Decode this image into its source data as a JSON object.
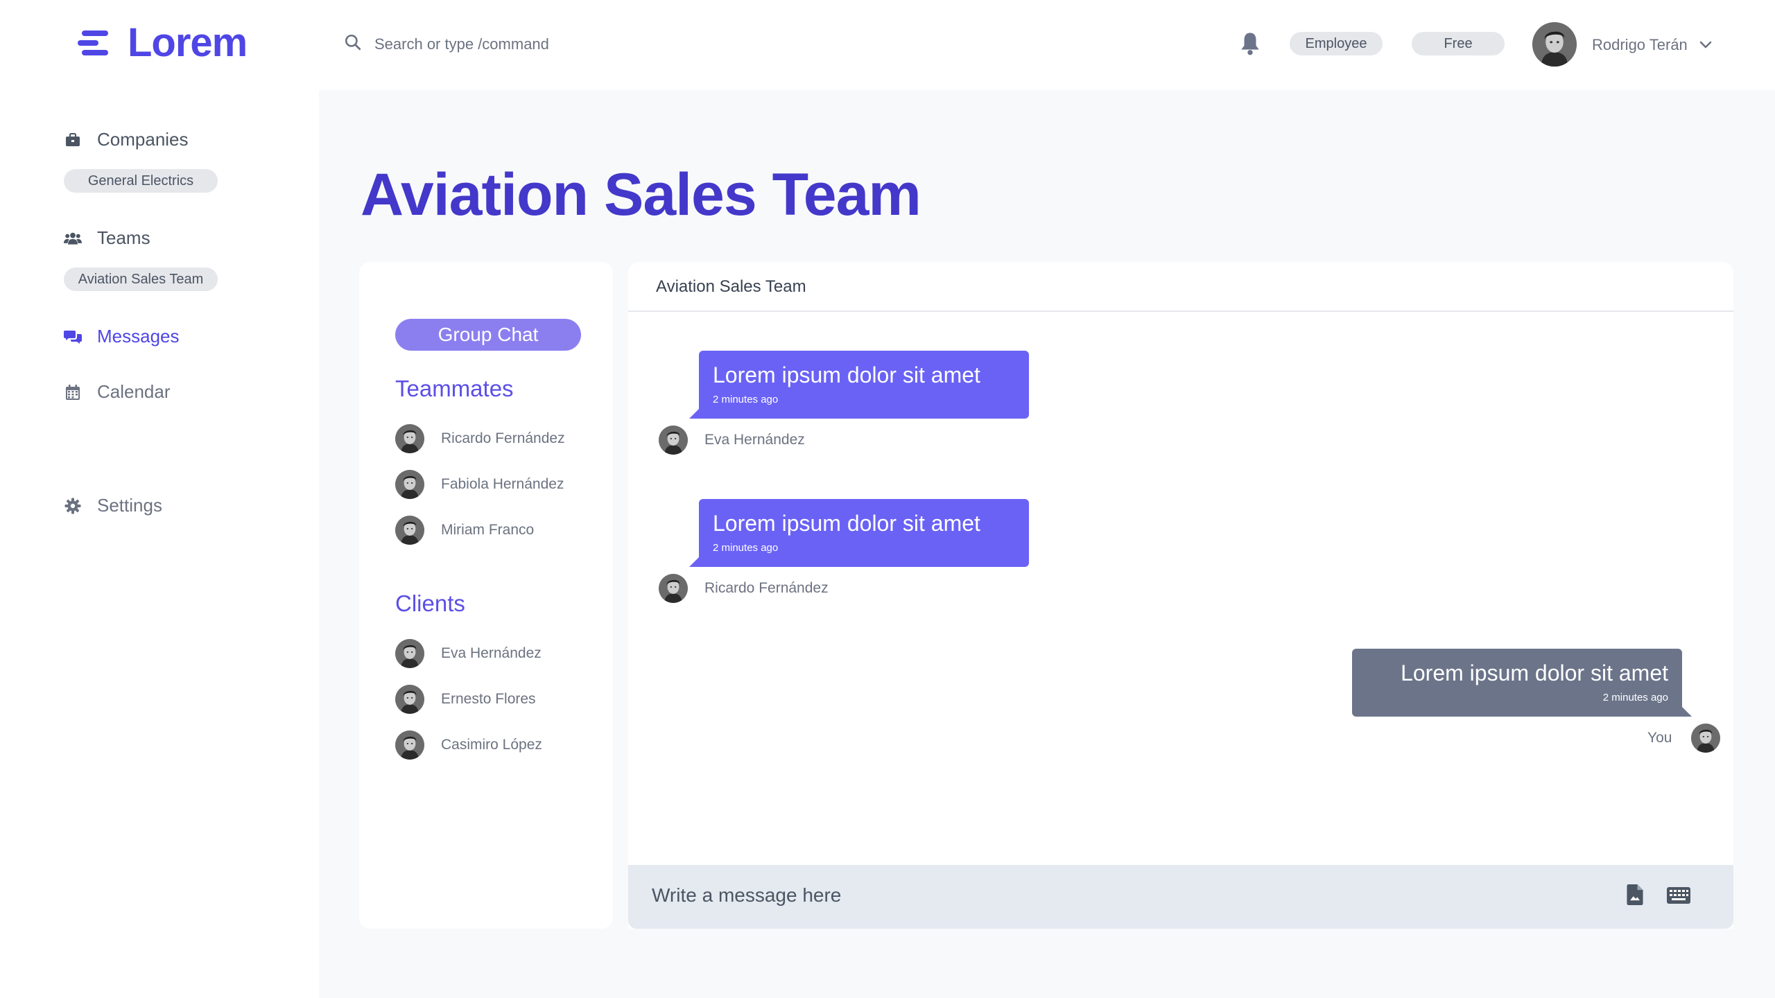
{
  "app": {
    "logo_text": "Lorem"
  },
  "header": {
    "search_placeholder": "Search or type /command",
    "badges": [
      "Employee",
      "Free"
    ],
    "user_name": "Rodrigo Terán"
  },
  "sidebar": {
    "companies_label": "Companies",
    "company_tag": "General Electrics",
    "teams_label": "Teams",
    "team_tag": "Aviation Sales Team",
    "messages_label": "Messages",
    "calendar_label": "Calendar",
    "settings_label": "Settings"
  },
  "page": {
    "title": "Aviation Sales Team"
  },
  "chat_list": {
    "group_chat_label": "Group Chat",
    "teammates_title": "Teammates",
    "teammates": [
      "Ricardo Fernández",
      "Fabiola Hernández",
      "Miriam Franco"
    ],
    "clients_title": "Clients",
    "clients": [
      "Eva Hernández",
      "Ernesto Flores",
      "Casimiro López"
    ]
  },
  "chat": {
    "header": "Aviation Sales Team",
    "messages": [
      {
        "text": "Lorem ipsum dolor sit amet",
        "time": "2 minutes ago",
        "sender": "Eva Hernández"
      },
      {
        "text": "Lorem ipsum dolor sit amet",
        "time": "2 minutes ago",
        "sender": "Ricardo Fernández"
      },
      {
        "text": "Lorem ipsum dolor sit amet",
        "time": "2 minutes ago",
        "sender": "You"
      }
    ],
    "composer_placeholder": "Write a message here"
  },
  "colors": {
    "accent": "#4f46e5",
    "incoming_bubble": "#6a62f5",
    "outgoing_bubble": "#6b7489",
    "group_chat_button": "#8b7ff0"
  },
  "icons": [
    "menu-logo-icon",
    "search-icon",
    "bell-icon",
    "chevron-down-icon",
    "briefcase-icon",
    "users-icon",
    "chat-bubbles-icon",
    "calendar-icon",
    "gear-icon",
    "file-icon",
    "keyboard-icon"
  ]
}
